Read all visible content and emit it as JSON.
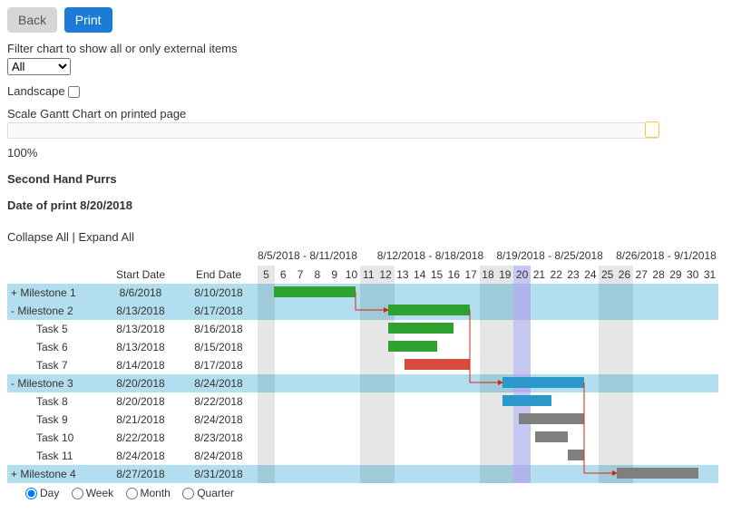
{
  "chart_data": {
    "type": "bar",
    "title": "Second Hand Purrs",
    "xlabel": "",
    "ylabel": "",
    "x_start": "8/5/2018",
    "x_end": "8/31/2018",
    "weeks": [
      "8/5/2018 - 8/11/2018",
      "8/12/2018 - 8/18/2018",
      "8/19/2018 - 8/25/2018",
      "8/26/2018 - 9/1/2018"
    ],
    "days": [
      5,
      6,
      7,
      8,
      9,
      10,
      11,
      12,
      13,
      14,
      15,
      16,
      17,
      18,
      19,
      20,
      21,
      22,
      23,
      24,
      25,
      26,
      27,
      28,
      29,
      30,
      31
    ],
    "weekend_indices": [
      0,
      6,
      7,
      13,
      14,
      20,
      21
    ],
    "today_index": 15,
    "tasks": [
      {
        "name": "Milestone 1",
        "start": "8/6/2018",
        "end": "8/10/2018",
        "level": 0,
        "expand": "+",
        "color": "green",
        "bar_start": 1,
        "bar_end": 6
      },
      {
        "name": "Milestone 2",
        "start": "8/13/2018",
        "end": "8/17/2018",
        "level": 0,
        "expand": "-",
        "color": "green",
        "bar_start": 8,
        "bar_end": 13
      },
      {
        "name": "Task 5",
        "start": "8/13/2018",
        "end": "8/16/2018",
        "level": 1,
        "color": "green",
        "bar_start": 8,
        "bar_end": 12
      },
      {
        "name": "Task 6",
        "start": "8/13/2018",
        "end": "8/15/2018",
        "level": 1,
        "color": "green",
        "bar_start": 8,
        "bar_end": 11
      },
      {
        "name": "Task 7",
        "start": "8/14/2018",
        "end": "8/17/2018",
        "level": 1,
        "color": "red",
        "bar_start": 9,
        "bar_end": 13
      },
      {
        "name": "Milestone 3",
        "start": "8/20/2018",
        "end": "8/24/2018",
        "level": 0,
        "expand": "-",
        "color": "blue",
        "bar_start": 15,
        "bar_end": 20
      },
      {
        "name": "Task 8",
        "start": "8/20/2018",
        "end": "8/22/2018",
        "level": 1,
        "color": "blue",
        "bar_start": 15,
        "bar_end": 18
      },
      {
        "name": "Task 9",
        "start": "8/21/2018",
        "end": "8/24/2018",
        "level": 1,
        "color": "grey",
        "bar_start": 16,
        "bar_end": 20
      },
      {
        "name": "Task 10",
        "start": "8/22/2018",
        "end": "8/23/2018",
        "level": 1,
        "color": "grey",
        "bar_start": 17,
        "bar_end": 19
      },
      {
        "name": "Task 11",
        "start": "8/24/2018",
        "end": "8/24/2018",
        "level": 1,
        "color": "grey",
        "bar_start": 19,
        "bar_end": 20
      },
      {
        "name": "Milestone 4",
        "start": "8/27/2018",
        "end": "8/31/2018",
        "level": 0,
        "expand": "+",
        "color": "grey",
        "bar_start": 22,
        "bar_end": 27
      }
    ],
    "dependencies": [
      {
        "from_row": 0,
        "from_col": 6,
        "to_row": 1,
        "to_col": 8
      },
      {
        "from_row": 1,
        "from_col": 13,
        "to_row": 5,
        "to_col": 15
      },
      {
        "from_row": 5,
        "from_col": 20,
        "to_row": 10,
        "to_col": 22
      }
    ]
  },
  "buttons": {
    "back": "Back",
    "print": "Print"
  },
  "filter": {
    "label": "Filter chart to show all or only external items",
    "value": "All"
  },
  "landscape": {
    "label": "Landscape"
  },
  "scale": {
    "label": "Scale Gantt Chart on printed page",
    "value": "100%"
  },
  "print_info": {
    "project": "Second Hand Purrs",
    "date_label": "Date of print 8/20/2018"
  },
  "tree": {
    "collapse": "Collapse All",
    "expand": "Expand All",
    "sep": " | "
  },
  "cols": {
    "start": "Start Date",
    "end": "End Date"
  },
  "radios": {
    "day": "Day",
    "week": "Week",
    "month": "Month",
    "quarter": "Quarter"
  }
}
